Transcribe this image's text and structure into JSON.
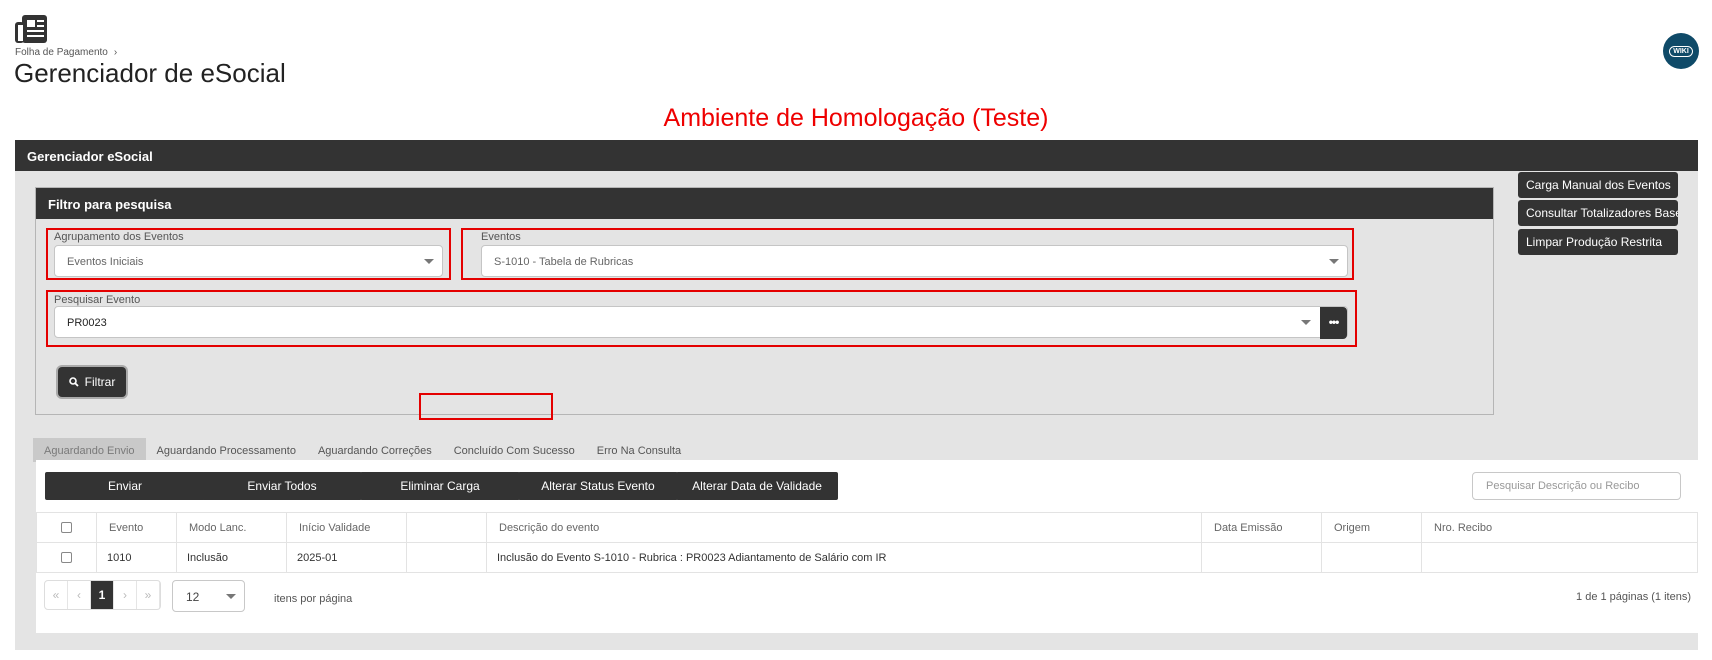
{
  "header": {
    "breadcrumb": "Folha de Pagamento",
    "title": "Gerenciador de eSocial",
    "wiki_label": "WIKI",
    "environment": "Ambiente de Homologação (Teste)"
  },
  "panel": {
    "title": "Gerenciador eSocial",
    "filter": {
      "title": "Filtro para pesquisa",
      "grouping_label": "Agrupamento dos Eventos",
      "grouping_value": "Eventos Iniciais",
      "events_label": "Eventos",
      "events_value": "S-1010 - Tabela de Rubricas",
      "search_label": "Pesquisar Evento",
      "search_value": "PR0023",
      "more_label": "•••",
      "filter_button": "Filtrar"
    },
    "side_buttons": [
      "Carga Manual dos Eventos",
      "Consultar Totalizadores Base",
      "Limpar Produção Restrita"
    ],
    "tabs": [
      "Aguardando Envio",
      "Aguardando Processamento",
      "Aguardando Correções",
      "Concluído Com Sucesso",
      "Erro Na Consulta"
    ],
    "actions": [
      "Enviar",
      "Enviar Todos",
      "Eliminar Carga",
      "Alterar Status Evento",
      "Alterar Data de Validade"
    ],
    "search_placeholder": "Pesquisar Descrição ou Recibo",
    "table": {
      "columns": [
        "Evento",
        "Modo Lanc.",
        "Início Validade",
        "",
        "Descrição do evento",
        "Data Emissão",
        "Origem",
        "Nro. Recibo"
      ],
      "rows": [
        [
          "1010",
          "Inclusão",
          "2025-01",
          "",
          "Inclusão do Evento S-1010 - Rubrica : PR0023 Adiantamento de Salário com IR",
          "",
          "",
          ""
        ]
      ]
    },
    "pagination": {
      "first": "«",
      "prev": "‹",
      "current": "1",
      "next": "›",
      "last": "»",
      "page_size": "12",
      "per_page_label": "itens por página",
      "info": "1 de 1 páginas (1 itens)"
    }
  }
}
